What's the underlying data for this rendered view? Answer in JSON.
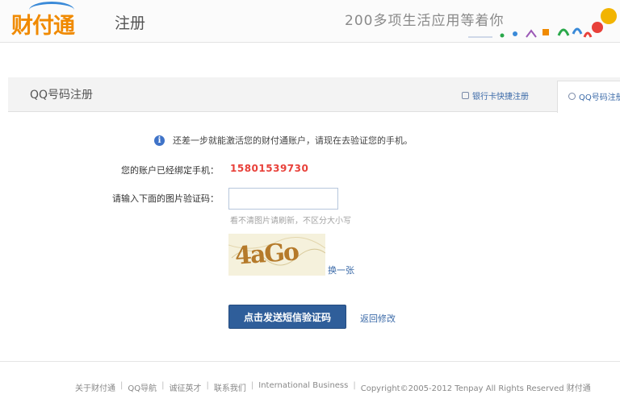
{
  "header": {
    "logo_text": "财付通",
    "register_title": "注册",
    "slogan": "200多项生活应用等着你"
  },
  "tabs": {
    "title": "QQ号码注册",
    "bank_card": "银行卡快捷注册",
    "qq_tab": "QQ号码注册"
  },
  "notice": {
    "icon": "info-icon",
    "text": "还差一步就能激活您的财付通账户，请现在去验证您的手机。"
  },
  "form": {
    "phone_label": "您的账户已经绑定手机：",
    "phone_value": "15801539730",
    "code_label": "请输入下面的图片验证码：",
    "code_value": "",
    "hint": "看不清图片请刷新，不区分大小写",
    "captcha_text": "4aGo",
    "refresh_label": "换一张",
    "submit_label": "点击发送短信验证码",
    "back_label": "返回修改"
  },
  "footer": {
    "links": [
      "关于财付通",
      "QQ导航",
      "诚征英才",
      "联系我们",
      "International Business"
    ],
    "copyright": "Copyright©2005-2012 Tenpay All Rights Reserved 财付通"
  },
  "colors": {
    "accent": "#2f5e9a",
    "phone": "#e8413a",
    "link": "#3b6aa8",
    "logo": "#f08a00"
  }
}
